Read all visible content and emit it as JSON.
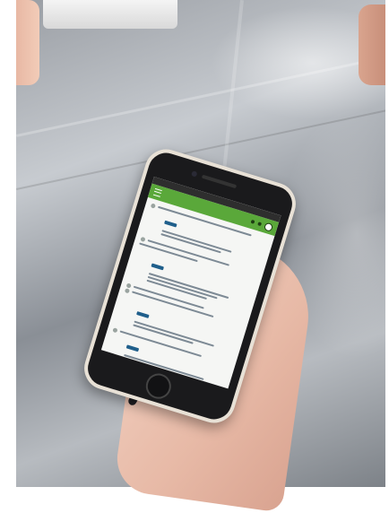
{
  "scene": {
    "subject": "hand-holding-phone",
    "app_header_color": "#5aa83a",
    "tag_color": "#1f5f8b",
    "case_color": "#e8e1d6",
    "surface": "stainless-steel",
    "icons": [
      "menu-icon",
      "avatar-icon"
    ]
  }
}
